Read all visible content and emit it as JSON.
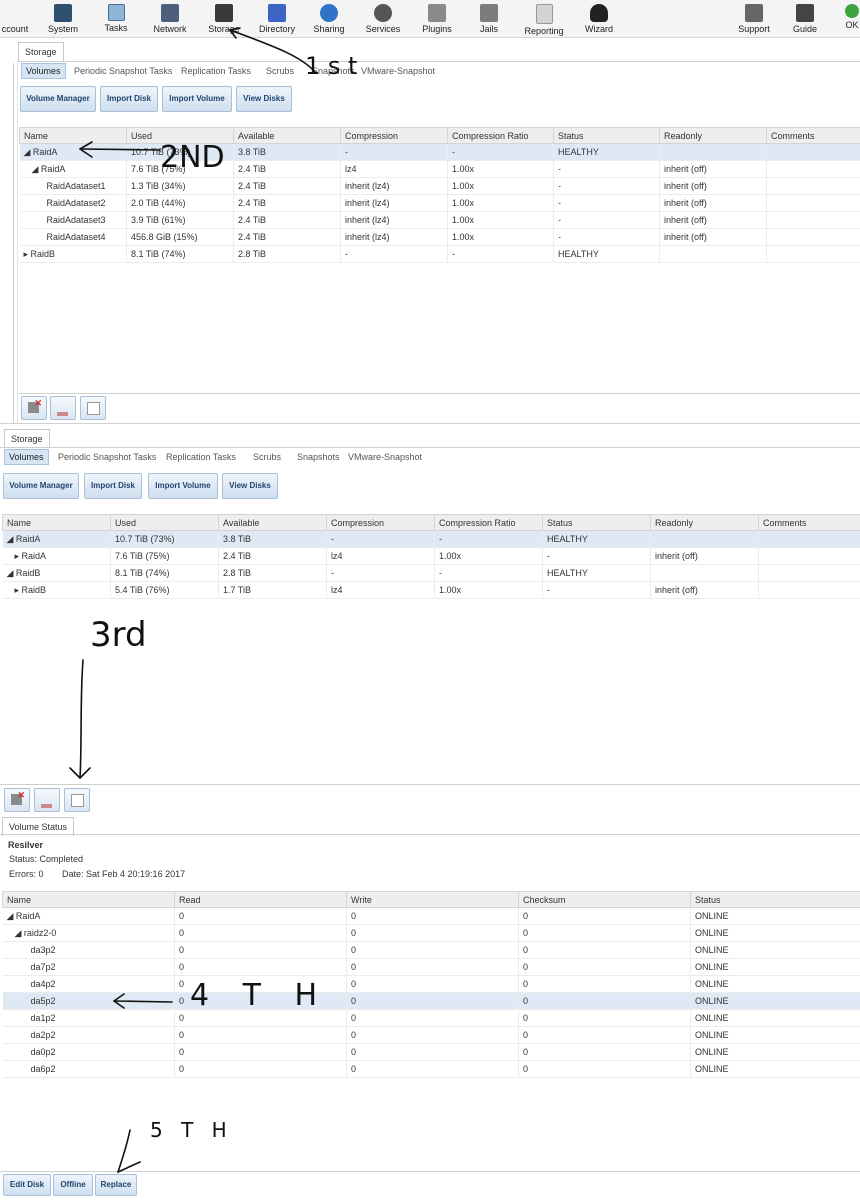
{
  "toolbar": {
    "items": [
      "ccount",
      "System",
      "Tasks",
      "Network",
      "Storage",
      "Directory",
      "Sharing",
      "Services",
      "Plugins",
      "Jails",
      "Reporting",
      "Wizard",
      "Support",
      "Guide",
      "OK"
    ]
  },
  "panel1": {
    "tab": "Storage",
    "subtabs": [
      "Volumes",
      "Periodic Snapshot Tasks",
      "Replication Tasks",
      "Scrubs",
      "Snapshots",
      "VMware-Snapshot"
    ],
    "buttons": [
      "Volume Manager",
      "Import Disk",
      "Import Volume",
      "View Disks"
    ],
    "columns": [
      "Name",
      "Used",
      "Available",
      "Compression",
      "Compression Ratio",
      "Status",
      "Readonly",
      "Comments"
    ],
    "rows": [
      {
        "name": "RaidA",
        "used": "10.7 TiB (73%)",
        "avail": "3.8 TiB",
        "comp": "-",
        "ratio": "-",
        "status": "HEALTHY",
        "ro": "",
        "comments": ""
      },
      {
        "name": "RaidA",
        "used": "7.6 TiB (75%)",
        "avail": "2.4 TiB",
        "comp": "lz4",
        "ratio": "1.00x",
        "status": "-",
        "ro": "inherit (off)",
        "comments": ""
      },
      {
        "name": "RaidAdataset1",
        "used": "1.3 TiB (34%)",
        "avail": "2.4 TiB",
        "comp": "inherit (lz4)",
        "ratio": "1.00x",
        "status": "-",
        "ro": "inherit (off)",
        "comments": ""
      },
      {
        "name": "RaidAdataset2",
        "used": "2.0 TiB (44%)",
        "avail": "2.4 TiB",
        "comp": "inherit (lz4)",
        "ratio": "1.00x",
        "status": "-",
        "ro": "inherit (off)",
        "comments": ""
      },
      {
        "name": "RaidAdataset3",
        "used": "3.9 TiB (61%)",
        "avail": "2.4 TiB",
        "comp": "inherit (lz4)",
        "ratio": "1.00x",
        "status": "-",
        "ro": "inherit (off)",
        "comments": ""
      },
      {
        "name": "RaidAdataset4",
        "used": "456.8 GiB (15%)",
        "avail": "2.4 TiB",
        "comp": "inherit (lz4)",
        "ratio": "1.00x",
        "status": "-",
        "ro": "inherit (off)",
        "comments": ""
      },
      {
        "name": "RaidB",
        "used": "8.1 TiB (74%)",
        "avail": "2.8 TiB",
        "comp": "-",
        "ratio": "-",
        "status": "HEALTHY",
        "ro": "",
        "comments": ""
      }
    ]
  },
  "panel2": {
    "tab": "Storage",
    "subtabs": [
      "Volumes",
      "Periodic Snapshot Tasks",
      "Replication Tasks",
      "Scrubs",
      "Snapshots",
      "VMware-Snapshot"
    ],
    "buttons": [
      "Volume Manager",
      "Import Disk",
      "Import Volume",
      "View Disks"
    ],
    "columns": [
      "Name",
      "Used",
      "Available",
      "Compression",
      "Compression Ratio",
      "Status",
      "Readonly",
      "Comments"
    ],
    "rows": [
      {
        "name": "RaidA",
        "used": "10.7 TiB (73%)",
        "avail": "3.8 TiB",
        "comp": "-",
        "ratio": "-",
        "status": "HEALTHY",
        "ro": "",
        "comments": ""
      },
      {
        "name": "RaidA",
        "used": "7.6 TiB (75%)",
        "avail": "2.4 TiB",
        "comp": "lz4",
        "ratio": "1.00x",
        "status": "-",
        "ro": "inherit (off)",
        "comments": ""
      },
      {
        "name": "RaidB",
        "used": "8.1 TiB (74%)",
        "avail": "2.8 TiB",
        "comp": "-",
        "ratio": "-",
        "status": "HEALTHY",
        "ro": "",
        "comments": ""
      },
      {
        "name": "RaidB",
        "used": "5.4 TiB (76%)",
        "avail": "1.7 TiB",
        "comp": "lz4",
        "ratio": "1.00x",
        "status": "-",
        "ro": "inherit (off)",
        "comments": ""
      }
    ]
  },
  "panel3": {
    "tab": "Volume Status",
    "heading": "Resilver",
    "status_line": "Status: Completed",
    "errors_line": "Errors: 0",
    "date_line": "Date: Sat Feb 4 20:19:16 2017",
    "columns": [
      "Name",
      "Read",
      "Write",
      "Checksum",
      "Status"
    ],
    "rows": [
      {
        "name": "RaidA",
        "read": "0",
        "write": "0",
        "checksum": "0",
        "status": "ONLINE"
      },
      {
        "name": "raidz2-0",
        "read": "0",
        "write": "0",
        "checksum": "0",
        "status": "ONLINE"
      },
      {
        "name": "da3p2",
        "read": "0",
        "write": "0",
        "checksum": "0",
        "status": "ONLINE"
      },
      {
        "name": "da7p2",
        "read": "0",
        "write": "0",
        "checksum": "0",
        "status": "ONLINE"
      },
      {
        "name": "da4p2",
        "read": "0",
        "write": "0",
        "checksum": "0",
        "status": "ONLINE"
      },
      {
        "name": "da5p2",
        "read": "0",
        "write": "0",
        "checksum": "0",
        "status": "ONLINE"
      },
      {
        "name": "da1p2",
        "read": "0",
        "write": "0",
        "checksum": "0",
        "status": "ONLINE"
      },
      {
        "name": "da2p2",
        "read": "0",
        "write": "0",
        "checksum": "0",
        "status": "ONLINE"
      },
      {
        "name": "da0p2",
        "read": "0",
        "write": "0",
        "checksum": "0",
        "status": "ONLINE"
      },
      {
        "name": "da6p2",
        "read": "0",
        "write": "0",
        "checksum": "0",
        "status": "ONLINE"
      }
    ],
    "buttons": [
      "Edit Disk",
      "Offline",
      "Replace"
    ]
  },
  "annotations": {
    "first": "1 s t",
    "second": "2ND",
    "third": "3rd",
    "fourth": "4 T H",
    "fifth": "5 T H"
  }
}
